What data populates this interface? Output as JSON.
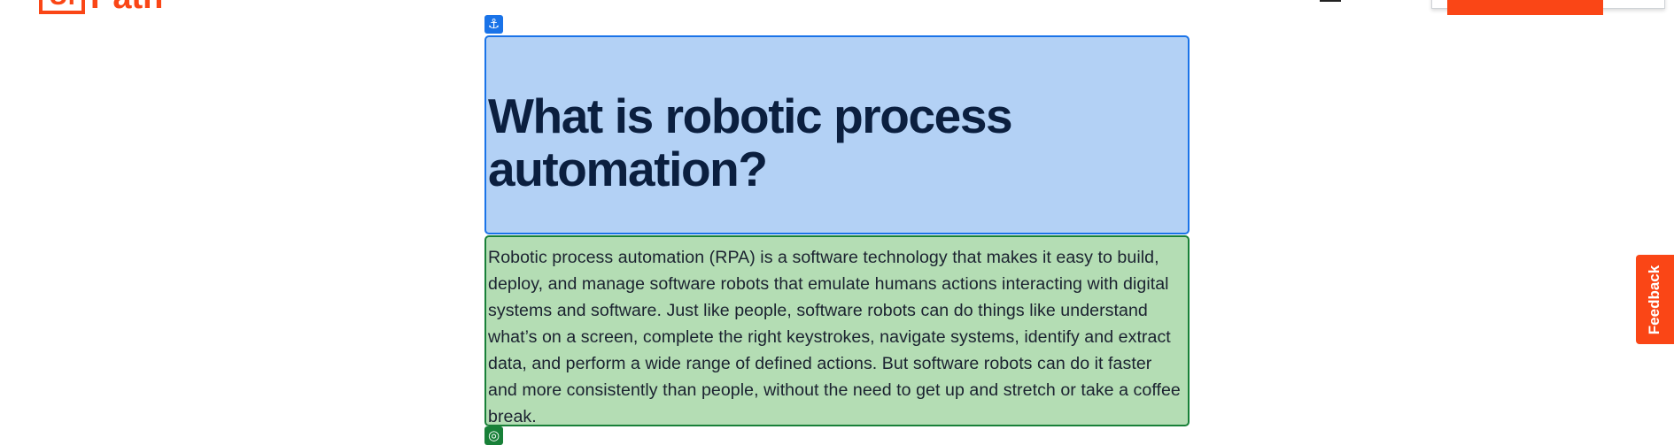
{
  "brand": {
    "logo_box_text": "Ui",
    "logo_word": "Path",
    "accent": "#fa4616"
  },
  "markers": {
    "anchor_icon": "anchor-icon",
    "anchor_glyph": "⚓",
    "target_icon": "target-icon",
    "target_glyph": "◎"
  },
  "article": {
    "heading": "What is robotic process automation?",
    "paragraph": "Robotic process automation (RPA) is a software technology that makes it easy to build, deploy, and manage software robots that emulate humans actions interacting with digital systems and software. Just like people, software robots can do things like understand what’s on a screen, complete the right keystrokes, navigate systems, identify and extract data, and perform a wide range of defined actions. But software robots can do it faster and more consistently than people, without the need to get up and stretch or take a coffee break."
  },
  "feedback": {
    "label": "Feedback"
  },
  "colors": {
    "heading_highlight": "#b3d1f5",
    "heading_border": "#1a73e8",
    "paragraph_highlight": "#b4ddb4",
    "paragraph_border": "#188038",
    "heading_text": "#0b1f3f"
  }
}
